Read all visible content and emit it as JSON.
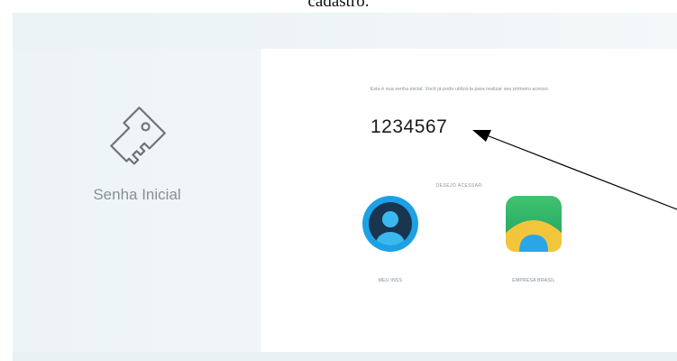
{
  "document": {
    "caption_fragment": "cadastro."
  },
  "left_panel": {
    "icon": "key-icon",
    "title": "Senha Inicial"
  },
  "content": {
    "intro_text": "Esta é sua senha inicial. Você já pode utilizá-la para realizar seu primeiro acesso.",
    "password": "1234567",
    "choose_label": "DESEJO ACESSAR:",
    "apps": [
      {
        "label": "MEU INSS",
        "icon": "meu-inss-icon",
        "color": "#1da1e6"
      },
      {
        "label": "EMPRESA BRASIL",
        "icon": "empresa-brasil-icon",
        "color": "#2db36a"
      }
    ]
  },
  "colors": {
    "panel_bg": "#edf4f6",
    "card_bg": "#ffffff",
    "muted_text": "#8a8f94",
    "meu_inss_blue": "#1da1e6",
    "meu_inss_navy": "#1a3550",
    "empresa_green": "#2db36a",
    "empresa_yellow": "#f2c53d",
    "annotation": "#000000"
  }
}
